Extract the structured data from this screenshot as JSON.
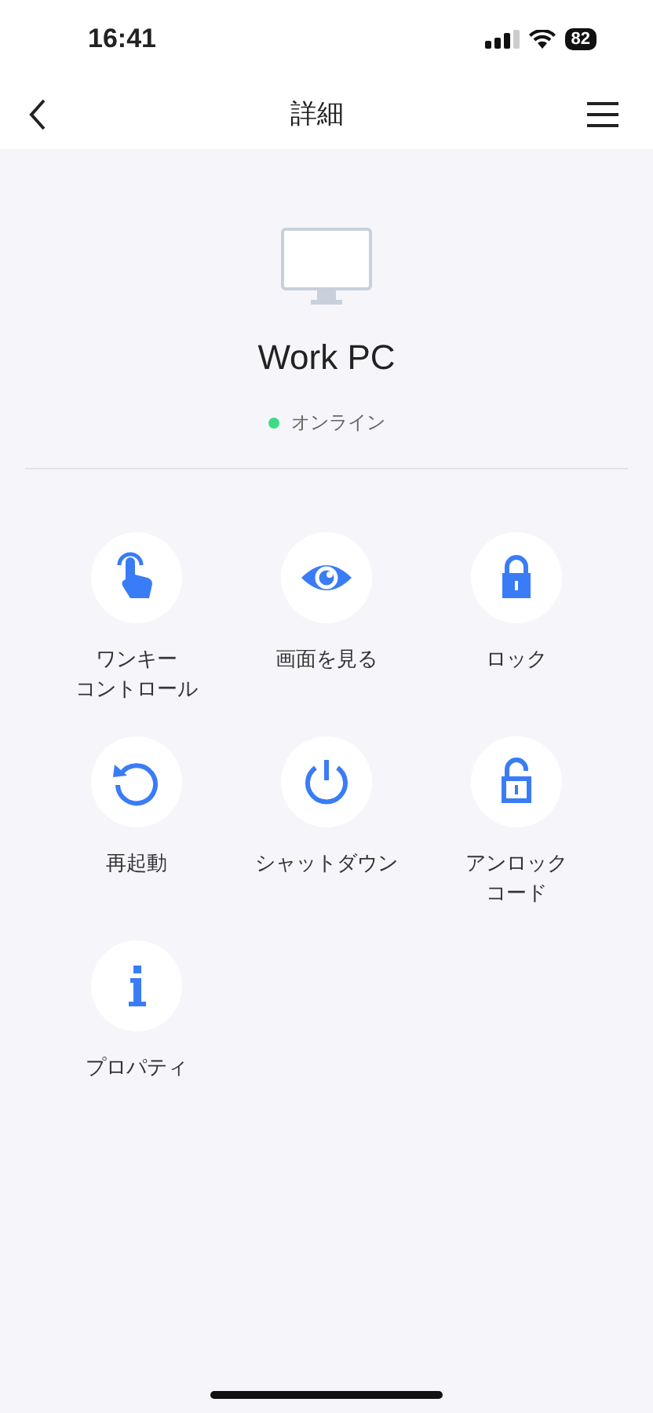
{
  "status_bar": {
    "time": "16:41",
    "battery": "82"
  },
  "nav": {
    "title": "詳細"
  },
  "device": {
    "name": "Work PC",
    "status": "オンライン",
    "online": true
  },
  "actions": [
    {
      "kind": "touch",
      "lines": [
        "ワンキー",
        "コントロール"
      ]
    },
    {
      "kind": "eye",
      "lines": [
        "画面を見る"
      ]
    },
    {
      "kind": "lock",
      "lines": [
        "ロック"
      ]
    },
    {
      "kind": "restart",
      "lines": [
        "再起動"
      ]
    },
    {
      "kind": "power",
      "lines": [
        "シャットダウン"
      ]
    },
    {
      "kind": "unlock",
      "lines": [
        "アンロック",
        "コード"
      ]
    },
    {
      "kind": "info",
      "lines": [
        "プロパティ"
      ]
    }
  ]
}
